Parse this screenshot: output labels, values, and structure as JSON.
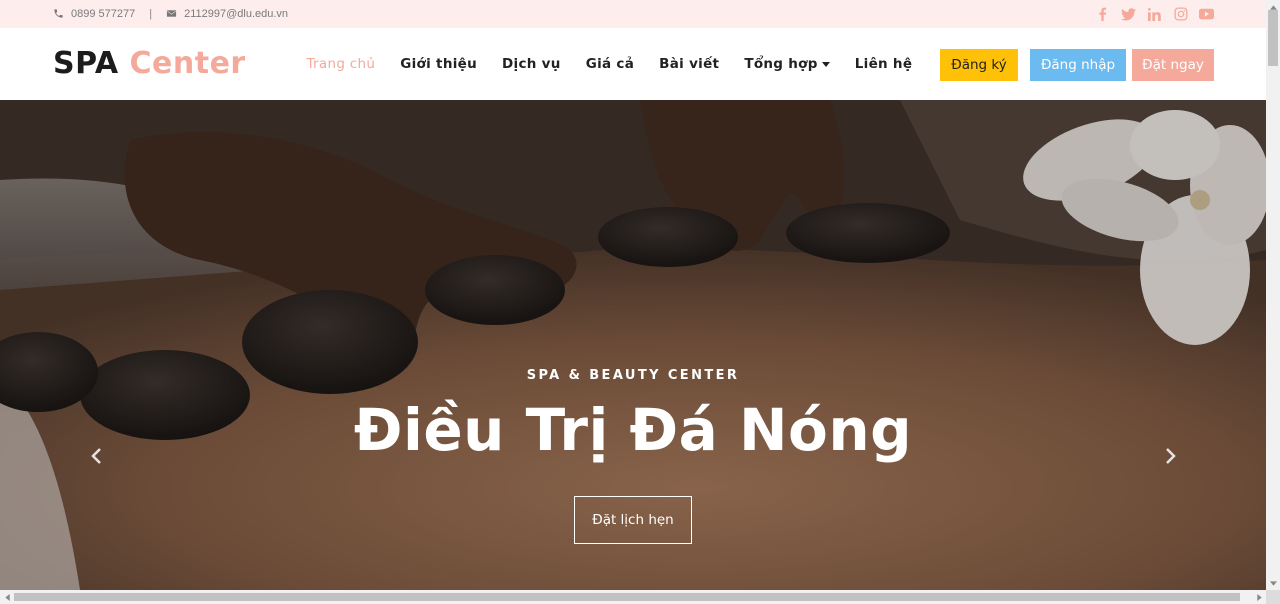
{
  "topbar": {
    "phone": "0899 577277",
    "separator": "|",
    "email": "2112997@dlu.edu.vn",
    "social_icons": [
      "facebook-icon",
      "twitter-icon",
      "linkedin-icon",
      "instagram-icon",
      "youtube-icon"
    ],
    "social_color": "#f4a99b"
  },
  "logo": {
    "part1": "SPA",
    "part2": "Center"
  },
  "nav": {
    "items": [
      {
        "label": "Trang chủ",
        "active": true
      },
      {
        "label": "Giới thiệu"
      },
      {
        "label": "Dịch vụ"
      },
      {
        "label": "Giá cả"
      },
      {
        "label": "Bài viết"
      },
      {
        "label": "Tổng hợp",
        "dropdown": true
      },
      {
        "label": "Liên hệ"
      }
    ]
  },
  "buttons": {
    "register": "Đăng ký",
    "login": "Đăng nhập",
    "book": "Đặt ngay"
  },
  "hero": {
    "subtitle": "SPA & BEAUTY CENTER",
    "title": "Điều Trị Đá Nóng",
    "cta": "Đặt lịch hẹn"
  },
  "colors": {
    "accent": "#f4a99b",
    "register_bg": "#ffc107",
    "login_bg": "#6bbaf0",
    "topbar_bg": "#fdeeed"
  }
}
